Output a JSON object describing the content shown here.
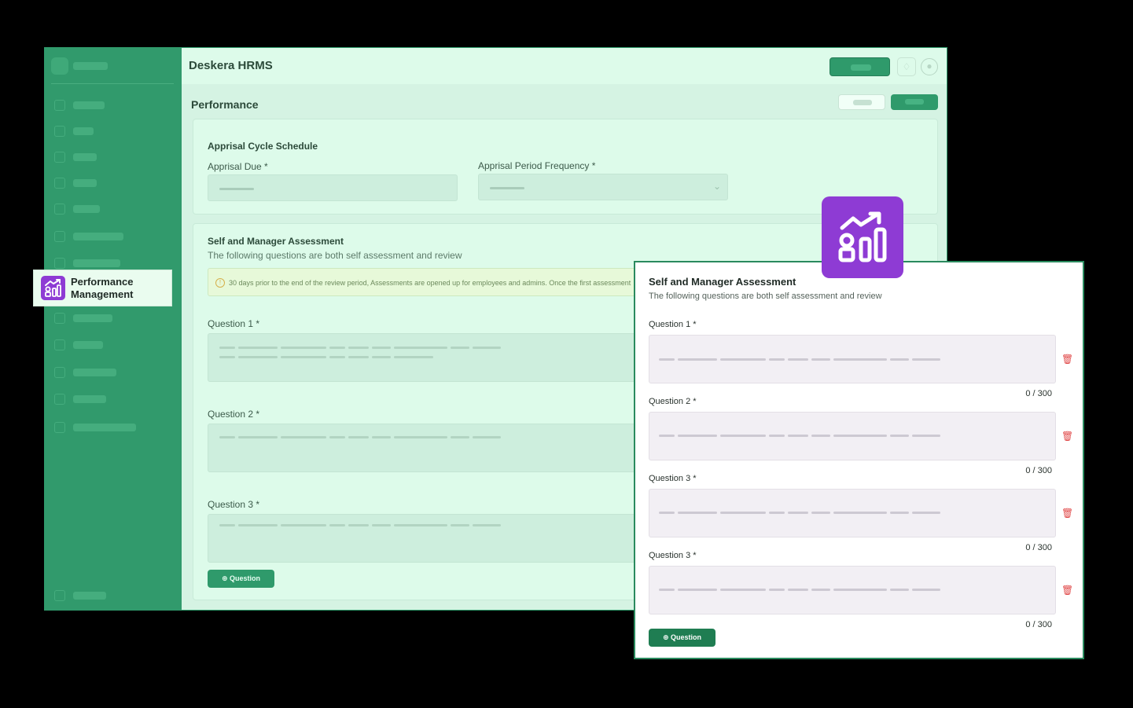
{
  "app": {
    "title": "Deskera HRMS",
    "page_title": "Performance"
  },
  "sidebar": {
    "badge_title_line1": "Performance",
    "badge_title_line2": "Management",
    "badge_icon": "performance-chart-icon"
  },
  "schedule": {
    "heading": "Apprisal Cycle Schedule",
    "due_label": "Apprisal Due *",
    "frequency_label": "Apprisal Period Frequency *"
  },
  "assessment": {
    "heading": "Self and Manager Assessment",
    "subtitle": "The following questions are both self assessment and review",
    "notice": "30 days prior to the end of the review period, Assessments are opened up for employees and admins. Once the first assessment",
    "questions": [
      "Question 1 *",
      "Question 2 *",
      "Question 3 *"
    ],
    "add_button": "⊕ Question"
  },
  "front_card": {
    "heading": "Self and Manager Assessment",
    "subtitle": "The following questions are both self assessment and review",
    "questions": [
      {
        "label": "Question 1 *",
        "count": "0 / 300"
      },
      {
        "label": "Question 2 *",
        "count": "0 / 300"
      },
      {
        "label": "Question 3 *",
        "count": "0 / 300"
      },
      {
        "label": "Question 3 *",
        "count": "0 / 300"
      }
    ],
    "add_button": "⊕ Question"
  },
  "icons": {
    "delete": "trash-icon",
    "bell": "bell-icon",
    "avatar": "user-icon",
    "info": "info-icon",
    "chevron": "chevron-down-icon"
  },
  "colors": {
    "brand_green": "#2f9a6b",
    "accent_purple": "#8e3bd4",
    "delete_red": "#e04848"
  }
}
